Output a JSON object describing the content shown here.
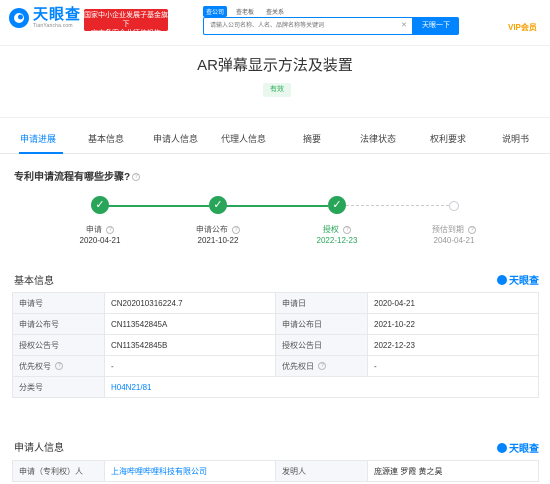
{
  "header": {
    "logo_cn": "天眼查",
    "logo_en": "TianYancha.com",
    "promo_line1": "国家中小企业发展子基金旗下",
    "promo_line2": "官方备案企业征信机构",
    "search_tabs": [
      "查公司",
      "查老板",
      "查关系"
    ],
    "search_placeholder": "请输入公司名称、人名、品牌名称等关键词",
    "search_button": "天眼一下",
    "vip": "VIP会员"
  },
  "title": {
    "text": "AR弹幕显示方法及装置",
    "status": "有效"
  },
  "tabs": [
    "申请进展",
    "基本信息",
    "申请人信息",
    "代理人信息",
    "摘要",
    "法律状态",
    "权利要求",
    "说明书"
  ],
  "flow": {
    "heading": "专利申请流程有哪些步骤?",
    "steps": [
      {
        "label": "申请",
        "date": "2020-04-21"
      },
      {
        "label": "申请公布",
        "date": "2021-10-22"
      },
      {
        "label": "授权",
        "date": "2022-12-23"
      },
      {
        "label": "预估到期",
        "date": "2040-04-21"
      }
    ]
  },
  "basic": {
    "title": "基本信息",
    "brand": "天眼查",
    "rows": [
      {
        "l1": "申请号",
        "v1": "CN202010316224.7",
        "l2": "申请日",
        "v2": "2020-04-21"
      },
      {
        "l1": "申请公布号",
        "v1": "CN113542845A",
        "l2": "申请公布日",
        "v2": "2021-10-22"
      },
      {
        "l1": "授权公告号",
        "v1": "CN113542845B",
        "l2": "授权公告日",
        "v2": "2022-12-23"
      },
      {
        "l1": "优先权号",
        "v1": "-",
        "l2": "优先权日",
        "v2": "-"
      },
      {
        "l1": "分类号",
        "v1": "H04N21/81"
      }
    ]
  },
  "applicant": {
    "title": "申请人信息",
    "brand": "天眼查",
    "l1": "申请（专利权）人",
    "v1": "上海哔哩哔哩科技有限公司",
    "l2": "发明人",
    "v2": "庞源連 罗霞 黄之昊"
  },
  "colors": {
    "accent": "#0084ff",
    "success": "#29a55a",
    "vip": "#f5a000",
    "promo": "#e8262a"
  }
}
